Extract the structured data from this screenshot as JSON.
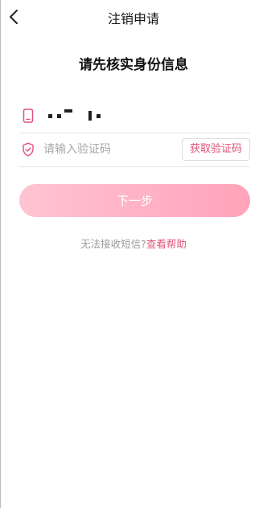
{
  "nav": {
    "title": "注销申请"
  },
  "heading": "请先核实身份信息",
  "phone": {
    "icon": "phone-icon"
  },
  "verification": {
    "icon": "shield-icon",
    "placeholder": "请输入验证码",
    "value": "",
    "get_code_label": "获取验证码"
  },
  "next_button_label": "下一步",
  "help": {
    "text": "无法接收短信?",
    "link": "查看帮助"
  },
  "colors": {
    "accent": "#e0527a",
    "button_gradient_start": "#ffc4d2",
    "button_gradient_end": "#ffa3b9"
  }
}
